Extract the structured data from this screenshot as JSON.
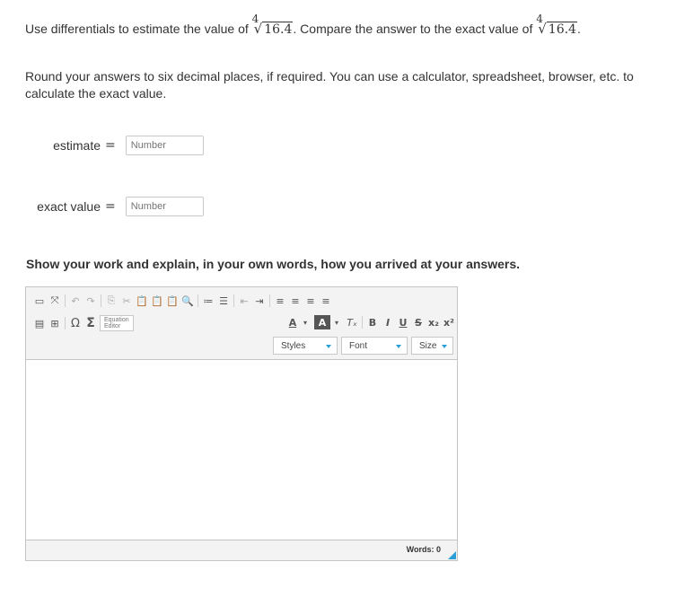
{
  "question": {
    "lead": "Use differentials to estimate the value of",
    "root_index": "4",
    "radicand": "16.4",
    "mid": ". Compare the answer to the exact value of",
    "end": ".",
    "instructions": "Round your answers to six decimal places, if required. You can use a calculator, spreadsheet, browser, etc. to calculate the exact value."
  },
  "fields": {
    "estimate": {
      "label": "estimate",
      "eq": "=",
      "placeholder": "Number",
      "value": ""
    },
    "exact": {
      "label": "exact value",
      "eq": "=",
      "placeholder": "Number",
      "value": ""
    }
  },
  "work_prompt": "Show your work and explain, in your own words, how you arrived at your answers.",
  "editor": {
    "equation_editor_label_1": "Equation",
    "equation_editor_label_2": "Editor",
    "styles_label": "Styles",
    "font_label": "Font",
    "size_label": "Size",
    "words_label": "Words: 0",
    "content": ""
  },
  "colors": {
    "accent": "#2a9fd6",
    "border": "#c4c4c4",
    "toolbar_bg": "#f3f3f3"
  }
}
